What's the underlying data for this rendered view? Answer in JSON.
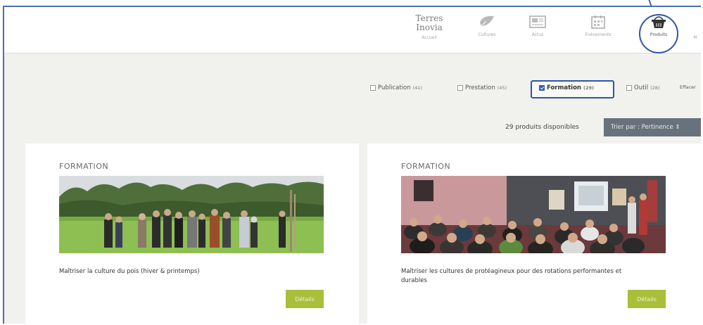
{
  "header": {
    "brand_line1": "Terres",
    "brand_line2": "Inovia",
    "brand_sub": "Accueil",
    "nav": [
      {
        "label": "Cultures"
      },
      {
        "label": "Actus"
      },
      {
        "label": "Evènements"
      },
      {
        "label": "Produits"
      },
      {
        "label": "M"
      }
    ]
  },
  "filters": [
    {
      "label": "Publication",
      "count": "(41)",
      "checked": false
    },
    {
      "label": "Prestation",
      "count": "(45)",
      "checked": false
    },
    {
      "label": "Formation",
      "count": "(29)",
      "checked": true
    },
    {
      "label": "Outil",
      "count": "(28)",
      "checked": false
    }
  ],
  "filters_clear": "Effacer",
  "results": {
    "count_text": "29 produits disponibles",
    "sort_label": "Trier par : Pertinence ⇕"
  },
  "cards": [
    {
      "type": "FORMATION",
      "title": "Maîtriser la culture du pois (hiver & printemps)",
      "button": "Détails"
    },
    {
      "type": "FORMATION",
      "title": "Maîtriser les cultures de protéagineux pour des rotations performantes et durables",
      "button": "Détails"
    }
  ],
  "colors": {
    "accent_blue": "#2d56a8",
    "button_green": "#a9bf3a",
    "sort_bg": "#68727d"
  }
}
